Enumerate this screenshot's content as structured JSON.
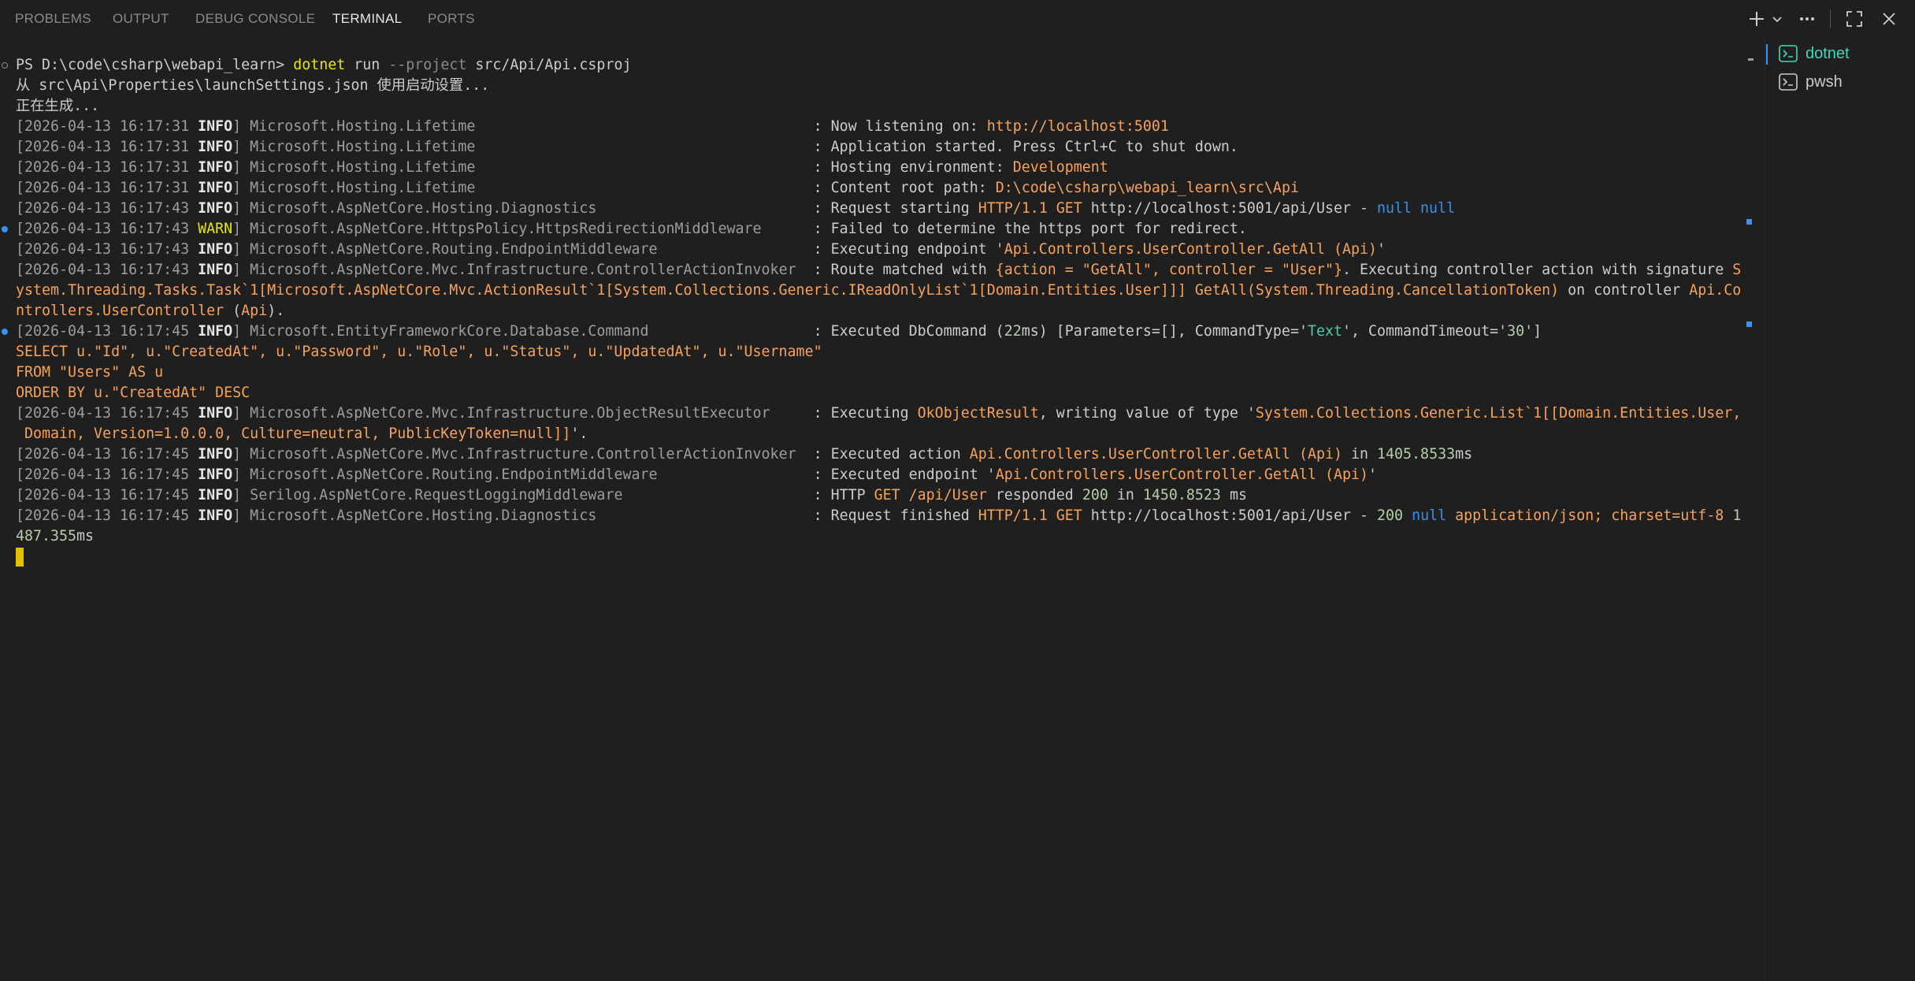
{
  "tabs": [
    {
      "label": "PROBLEMS",
      "active": false
    },
    {
      "label": "OUTPUT",
      "active": false
    },
    {
      "label": "DEBUG CONSOLE",
      "active": false
    },
    {
      "label": "TERMINAL",
      "active": true
    },
    {
      "label": "PORTS",
      "active": false
    }
  ],
  "toolbar_icons": [
    "add-icon",
    "chevron-down-icon",
    "more-icon",
    "maximize-icon",
    "close-icon"
  ],
  "terminal_list": [
    {
      "label": "dotnet",
      "active": true
    },
    {
      "label": "pwsh",
      "active": false
    }
  ],
  "colors": {
    "background": "#1f1f1f",
    "info": "#e5e5e5",
    "warn": "#e5e510",
    "string": "#f5a35b",
    "null": "#3b8eea",
    "number": "#b5cea8",
    "active_terminal": "#3fd9b9",
    "cursor": "#e5c000"
  },
  "lines": [
    {
      "deco": "hollow",
      "segs": [
        {
          "t": "PS D:\\code\\csharp\\webapi_learn> ",
          "c": ""
        },
        {
          "t": "dotnet",
          "c": "yellow"
        },
        {
          "t": " run ",
          "c": ""
        },
        {
          "t": "--project",
          "c": "dim"
        },
        {
          "t": " src/Api/Api.csproj",
          "c": ""
        }
      ]
    },
    {
      "segs": [
        {
          "t": "从 src\\Api\\Properties\\launchSettings.json 使用启动设置...",
          "c": ""
        }
      ]
    },
    {
      "segs": [
        {
          "t": "正在生成...",
          "c": ""
        }
      ]
    },
    {
      "segs": [
        {
          "t": "[2026-04-13 16:17:31 ",
          "c": "grey"
        },
        {
          "t": "INFO",
          "c": "white"
        },
        {
          "t": "] Microsoft.Hosting.Lifetime                                       ",
          "c": "grey"
        },
        {
          "t": ": Now listening on: ",
          "c": ""
        },
        {
          "t": "http://localhost:5001",
          "c": "orange"
        }
      ]
    },
    {
      "segs": [
        {
          "t": "[2026-04-13 16:17:31 ",
          "c": "grey"
        },
        {
          "t": "INFO",
          "c": "white"
        },
        {
          "t": "] Microsoft.Hosting.Lifetime                                       ",
          "c": "grey"
        },
        {
          "t": ": Application started. Press Ctrl+C to shut down.",
          "c": ""
        }
      ]
    },
    {
      "segs": [
        {
          "t": "[2026-04-13 16:17:31 ",
          "c": "grey"
        },
        {
          "t": "INFO",
          "c": "white"
        },
        {
          "t": "] Microsoft.Hosting.Lifetime                                       ",
          "c": "grey"
        },
        {
          "t": ": Hosting environment: ",
          "c": ""
        },
        {
          "t": "Development",
          "c": "orange"
        }
      ]
    },
    {
      "segs": [
        {
          "t": "[2026-04-13 16:17:31 ",
          "c": "grey"
        },
        {
          "t": "INFO",
          "c": "white"
        },
        {
          "t": "] Microsoft.Hosting.Lifetime                                       ",
          "c": "grey"
        },
        {
          "t": ": Content root path: ",
          "c": ""
        },
        {
          "t": "D:\\code\\csharp\\webapi_learn\\src\\Api",
          "c": "orange"
        }
      ]
    },
    {
      "segs": [
        {
          "t": "[2026-04-13 16:17:43 ",
          "c": "grey"
        },
        {
          "t": "INFO",
          "c": "white"
        },
        {
          "t": "] Microsoft.AspNetCore.Hosting.Diagnostics                         ",
          "c": "grey"
        },
        {
          "t": ": Request starting ",
          "c": ""
        },
        {
          "t": "HTTP/1.1 GET",
          "c": "orange"
        },
        {
          "t": " http://localhost:5001/api/User - ",
          "c": ""
        },
        {
          "t": "null null",
          "c": "blue"
        }
      ]
    },
    {
      "deco": "blue",
      "segs": [
        {
          "t": "[2026-04-13 16:17:43 ",
          "c": "grey"
        },
        {
          "t": "WARN",
          "c": "yellow"
        },
        {
          "t": "] Microsoft.AspNetCore.HttpsPolicy.HttpsRedirectionMiddleware      ",
          "c": "grey"
        },
        {
          "t": ": Failed to determine the https port for redirect.",
          "c": ""
        }
      ]
    },
    {
      "segs": [
        {
          "t": "[2026-04-13 16:17:43 ",
          "c": "grey"
        },
        {
          "t": "INFO",
          "c": "white"
        },
        {
          "t": "] Microsoft.AspNetCore.Routing.EndpointMiddleware                  ",
          "c": "grey"
        },
        {
          "t": ": Executing endpoint '",
          "c": ""
        },
        {
          "t": "Api.Controllers.UserController.GetAll (Api)",
          "c": "orange"
        },
        {
          "t": "'",
          "c": ""
        }
      ]
    },
    {
      "segs": [
        {
          "t": "[2026-04-13 16:17:43 ",
          "c": "grey"
        },
        {
          "t": "INFO",
          "c": "white"
        },
        {
          "t": "] Microsoft.AspNetCore.Mvc.Infrastructure.ControllerActionInvoker  ",
          "c": "grey"
        },
        {
          "t": ": Route matched with ",
          "c": ""
        },
        {
          "t": "{action = \"GetAll\", controller = \"User\"}",
          "c": "orange"
        },
        {
          "t": ". Executing controller action with signature ",
          "c": ""
        },
        {
          "t": "S",
          "c": "orange"
        }
      ]
    },
    {
      "segs": [
        {
          "t": "ystem.Threading.Tasks.Task`1[Microsoft.AspNetCore.Mvc.ActionResult`1[System.Collections.Generic.IReadOnlyList`1[Domain.Entities.User]]] GetAll(System.Threading.CancellationToken)",
          "c": "orange"
        },
        {
          "t": " on controller ",
          "c": ""
        },
        {
          "t": "Api.Co",
          "c": "orange"
        }
      ]
    },
    {
      "segs": [
        {
          "t": "ntrollers.UserController",
          "c": "orange"
        },
        {
          "t": " (",
          "c": ""
        },
        {
          "t": "Api",
          "c": "orange"
        },
        {
          "t": ").",
          "c": ""
        }
      ]
    },
    {
      "deco": "blue",
      "segs": [
        {
          "t": "[2026-04-13 16:17:45 ",
          "c": "grey"
        },
        {
          "t": "INFO",
          "c": "white"
        },
        {
          "t": "] Microsoft.EntityFrameworkCore.Database.Command                   ",
          "c": "grey"
        },
        {
          "t": ": Executed DbCommand (",
          "c": ""
        },
        {
          "t": "22",
          "c": "green"
        },
        {
          "t": "ms) [Parameters=[], CommandType='",
          "c": ""
        },
        {
          "t": "Text",
          "c": "teal"
        },
        {
          "t": "', CommandTimeout='",
          "c": ""
        },
        {
          "t": "30",
          "c": "green"
        },
        {
          "t": "']",
          "c": ""
        }
      ]
    },
    {
      "segs": [
        {
          "t": "SELECT u.\"Id\", u.\"CreatedAt\", u.\"Password\", u.\"Role\", u.\"Status\", u.\"UpdatedAt\", u.\"Username\"",
          "c": "orange"
        }
      ]
    },
    {
      "segs": [
        {
          "t": "FROM \"Users\" AS u",
          "c": "orange"
        }
      ]
    },
    {
      "segs": [
        {
          "t": "ORDER BY u.\"CreatedAt\" DESC",
          "c": "orange"
        }
      ]
    },
    {
      "segs": [
        {
          "t": "[2026-04-13 16:17:45 ",
          "c": "grey"
        },
        {
          "t": "INFO",
          "c": "white"
        },
        {
          "t": "] Microsoft.AspNetCore.Mvc.Infrastructure.ObjectResultExecutor     ",
          "c": "grey"
        },
        {
          "t": ": Executing ",
          "c": ""
        },
        {
          "t": "OkObjectResult",
          "c": "orange"
        },
        {
          "t": ", writing value of type '",
          "c": ""
        },
        {
          "t": "System.Collections.Generic.List`1[[Domain.Entities.User,",
          "c": "orange"
        }
      ]
    },
    {
      "segs": [
        {
          "t": " Domain, Version=1.0.0.0, Culture=neutral, PublicKeyToken=null]]",
          "c": "orange"
        },
        {
          "t": "'.",
          "c": ""
        }
      ]
    },
    {
      "segs": [
        {
          "t": "[2026-04-13 16:17:45 ",
          "c": "grey"
        },
        {
          "t": "INFO",
          "c": "white"
        },
        {
          "t": "] Microsoft.AspNetCore.Mvc.Infrastructure.ControllerActionInvoker  ",
          "c": "grey"
        },
        {
          "t": ": Executed action ",
          "c": ""
        },
        {
          "t": "Api.Controllers.UserController.GetAll (Api)",
          "c": "orange"
        },
        {
          "t": " in ",
          "c": ""
        },
        {
          "t": "1405.8533",
          "c": "green"
        },
        {
          "t": "ms",
          "c": ""
        }
      ]
    },
    {
      "segs": [
        {
          "t": "[2026-04-13 16:17:45 ",
          "c": "grey"
        },
        {
          "t": "INFO",
          "c": "white"
        },
        {
          "t": "] Microsoft.AspNetCore.Routing.EndpointMiddleware                  ",
          "c": "grey"
        },
        {
          "t": ": Executed endpoint '",
          "c": ""
        },
        {
          "t": "Api.Controllers.UserController.GetAll (Api)",
          "c": "orange"
        },
        {
          "t": "'",
          "c": ""
        }
      ]
    },
    {
      "segs": [
        {
          "t": "[2026-04-13 16:17:45 ",
          "c": "grey"
        },
        {
          "t": "INFO",
          "c": "white"
        },
        {
          "t": "] Serilog.AspNetCore.RequestLoggingMiddleware                      ",
          "c": "grey"
        },
        {
          "t": ": HTTP ",
          "c": ""
        },
        {
          "t": "GET /api/User",
          "c": "orange"
        },
        {
          "t": " responded ",
          "c": ""
        },
        {
          "t": "200",
          "c": "green"
        },
        {
          "t": " in ",
          "c": ""
        },
        {
          "t": "1450.8523",
          "c": "green"
        },
        {
          "t": " ms",
          "c": ""
        }
      ]
    },
    {
      "segs": [
        {
          "t": "[2026-04-13 16:17:45 ",
          "c": "grey"
        },
        {
          "t": "INFO",
          "c": "white"
        },
        {
          "t": "] Microsoft.AspNetCore.Hosting.Diagnostics                         ",
          "c": "grey"
        },
        {
          "t": ": Request finished ",
          "c": ""
        },
        {
          "t": "HTTP/1.1 GET",
          "c": "orange"
        },
        {
          "t": " http://localhost:5001/api/User - ",
          "c": ""
        },
        {
          "t": "200",
          "c": "green"
        },
        {
          "t": " ",
          "c": ""
        },
        {
          "t": "null",
          "c": "blue"
        },
        {
          "t": " ",
          "c": ""
        },
        {
          "t": "application/json; charset=utf-8",
          "c": "orange"
        },
        {
          "t": " ",
          "c": ""
        },
        {
          "t": "1",
          "c": "green"
        }
      ]
    },
    {
      "segs": [
        {
          "t": "487.355",
          "c": "green"
        },
        {
          "t": "ms",
          "c": ""
        }
      ]
    },
    {
      "cursor": true,
      "segs": []
    }
  ]
}
